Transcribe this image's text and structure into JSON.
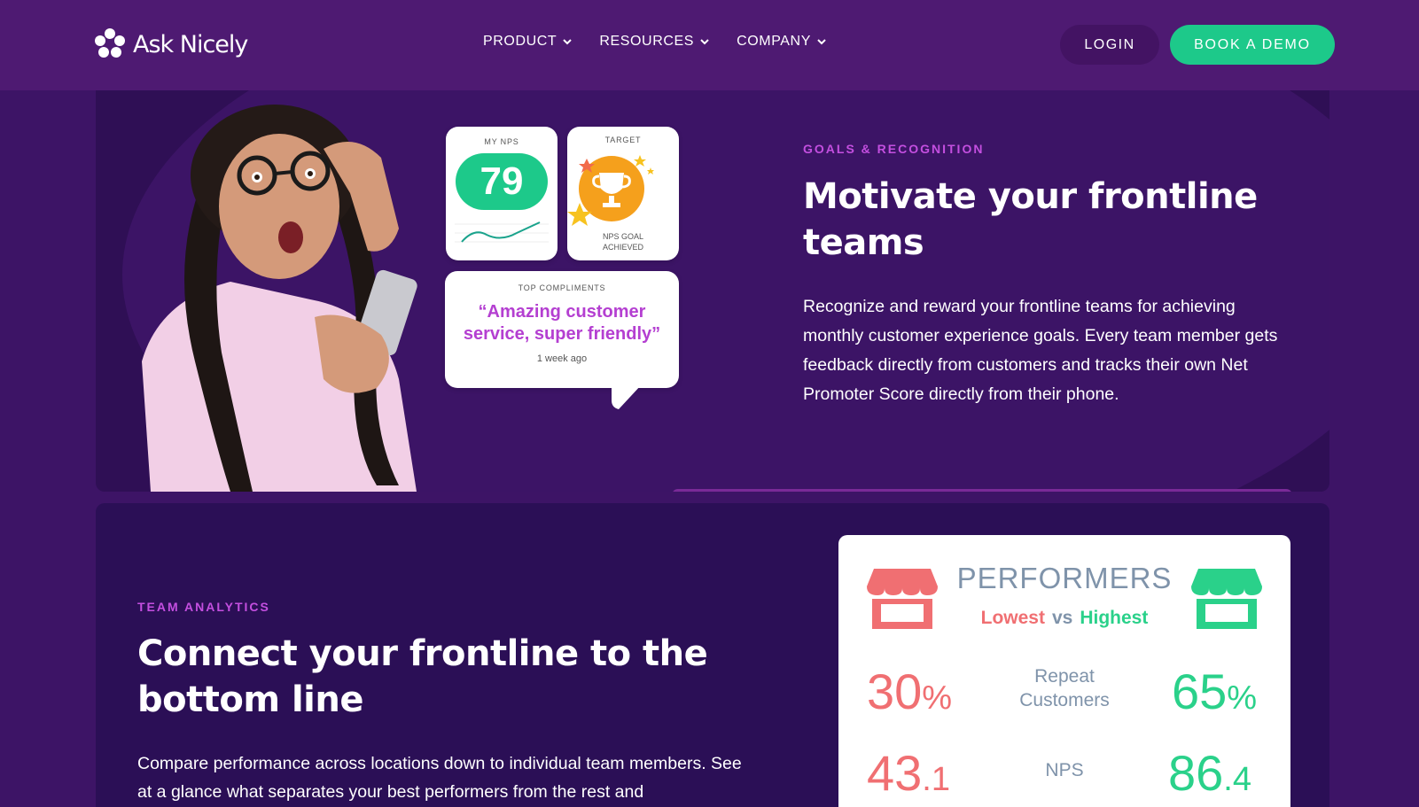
{
  "nav": {
    "logo_text": "Ask Nicely",
    "menu": [
      {
        "label": "PRODUCT"
      },
      {
        "label": "RESOURCES"
      },
      {
        "label": "COMPANY"
      }
    ],
    "login_label": "LOGIN",
    "demo_label": "BOOK A DEMO"
  },
  "goals": {
    "eyebrow": "GOALS & RECOGNITION",
    "title": "Motivate your frontline teams",
    "body": "Recognize and reward your frontline teams for achieving monthly customer experience goals. Every team member gets feedback directly from customers and tracks their own Net Promoter Score directly from their phone.",
    "widgets": {
      "nps_label": "MY NPS",
      "nps_value": "79",
      "target_label": "TARGET",
      "target_sub_1": "NPS GOAL",
      "target_sub_2": "ACHIEVED",
      "compliments_label": "TOP COMPLIMENTS",
      "compliment_quote": "“Amazing customer service, super friendly”",
      "compliment_time": "1 week ago"
    }
  },
  "analytics": {
    "eyebrow": "TEAM ANALYTICS",
    "title": "Connect your frontline to the bottom line",
    "body": "Compare performance across locations down to individual team members. See at a glance what separates your best performers from the rest and",
    "card": {
      "title": "PERFORMERS",
      "lowest_label": "Lowest",
      "vs_label": "vs",
      "highest_label": "Highest",
      "metrics": [
        {
          "label_1": "Repeat",
          "label_2": "Customers",
          "low_main": "30",
          "low_small": "%",
          "high_main": "65",
          "high_small": "%"
        },
        {
          "label_1": "NPS",
          "label_2": "",
          "low_main": "43",
          "low_small": ".1",
          "high_main": "86",
          "high_small": ".4"
        }
      ]
    }
  },
  "colors": {
    "brand_green": "#1dc98a",
    "accent_purple": "#c44fe0",
    "low_red": "#f06f72",
    "high_green": "#2ad18a"
  }
}
